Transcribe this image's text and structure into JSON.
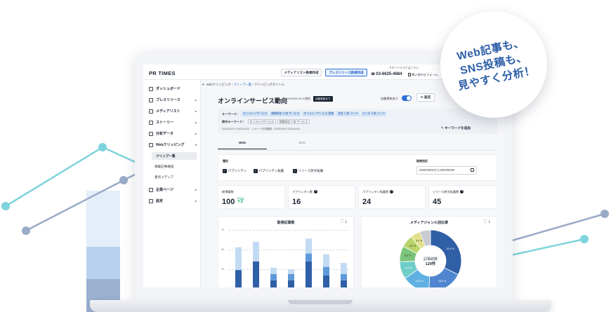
{
  "header": {
    "logo": "PR TIMES",
    "media_list_btn": "メディアリスト新規作成",
    "press_release_btn": "プレスリリース新規作成",
    "support_text": "サポートデスクはこちら",
    "phone": "03-6625-4684",
    "contact": "問い合わせフォーム"
  },
  "sidebar": {
    "items": [
      {
        "label": "ダッシュボード",
        "chevron": ""
      },
      {
        "label": "プレスリリース",
        "chevron": "▸"
      },
      {
        "label": "メディアリスト",
        "chevron": "▸"
      },
      {
        "label": "ストーリー",
        "chevron": "▸"
      },
      {
        "label": "分析データ",
        "chevron": "▸"
      },
      {
        "label": "Webクリッピング",
        "chevron": "▾"
      }
    ],
    "subitems": [
      "クリップ一覧",
      "掲載記事検索",
      "重点メディア"
    ],
    "bottom_items": [
      {
        "label": "企業ページ",
        "chevron": "▸"
      },
      {
        "label": "設定",
        "chevron": "▸"
      }
    ]
  },
  "breadcrumb": {
    "part1": "Webクリッピング",
    "part2": "クリップ一覧",
    "part3": "クリッピングタイトル"
  },
  "page": {
    "title": "オンラインサービス動向",
    "updated": "2023/08/00 00:00更新",
    "auto_badge": "自動更新あり",
    "auto_label": "自動更新あり",
    "settings": "設定"
  },
  "keywords": {
    "label": "キーワード：",
    "tags": [
      "オンラインサービス",
      "期間限定 人気 サービス",
      "オンラインサービス 飲食",
      "女性 人気 フード",
      "ランチ 人気 フード"
    ],
    "exclude_label": "除外キーワード：",
    "exclude_tags": [
      "オンラインサービス",
      "期間限定 人気 サービス"
    ],
    "meta": "2023/10/01〜2023/11/0/2　レポート作成期間：2023/9/28〜2023/10/02",
    "edit": "キーワードを追加"
  },
  "tabs": [
    "Web",
    "SNS"
  ],
  "filters": {
    "type_label": "種別",
    "checkboxes": [
      "パブリシティ",
      "パブリシティ転載",
      "リリース原文転載"
    ],
    "period_label": "期間指定",
    "period_value": "2000/00/00から2000/00/00"
  },
  "stats": [
    {
      "label": "総掲載数",
      "value": "100",
      "delta_label": "前日比",
      "delta": "+3"
    },
    {
      "label": "パブリシティ数",
      "value": "16"
    },
    {
      "label": "パブリシティ転載数",
      "value": "24"
    },
    {
      "label": "リリース原文転載数",
      "value": "45"
    }
  ],
  "bar_chart": {
    "title": "取得記事数",
    "y_ticks": [
      "75",
      "50",
      "25"
    ]
  },
  "pie_chart": {
    "title": "メディアジャンル別比率",
    "center_label": "記事総数",
    "center_value": "129件",
    "slice_labels": [
      "32.4 %",
      "18.5 %",
      "14.5 %",
      "9.2 %",
      "8.2 %",
      "6.5 %",
      "5.0 %"
    ]
  },
  "bubble": {
    "line1": "Web記事も、",
    "line2": "SNS投稿も、",
    "line3": "見やすく分析！"
  },
  "chart_data": {
    "type": "bar",
    "title": "取得記事数",
    "ylim": [
      0,
      75
    ],
    "series": [
      {
        "name": "",
        "values": [
          24,
          35,
          11,
          11,
          35,
          17,
          11
        ]
      },
      {
        "name": "",
        "values": [
          24,
          35,
          19,
          19,
          45,
          28,
          19
        ]
      },
      {
        "name": "",
        "values": [
          53,
          60,
          27,
          25,
          64,
          44,
          33
        ]
      }
    ],
    "categories": [
      "",
      "",
      "",
      "",
      "",
      "",
      ""
    ]
  },
  "colors": {
    "accent": "#2b6fd6",
    "navy": "#1b2434",
    "bubble_text": "#2c5ea8",
    "bg_line_teal": "#6fd0d8",
    "bg_line_navy": "#8da2bf"
  }
}
